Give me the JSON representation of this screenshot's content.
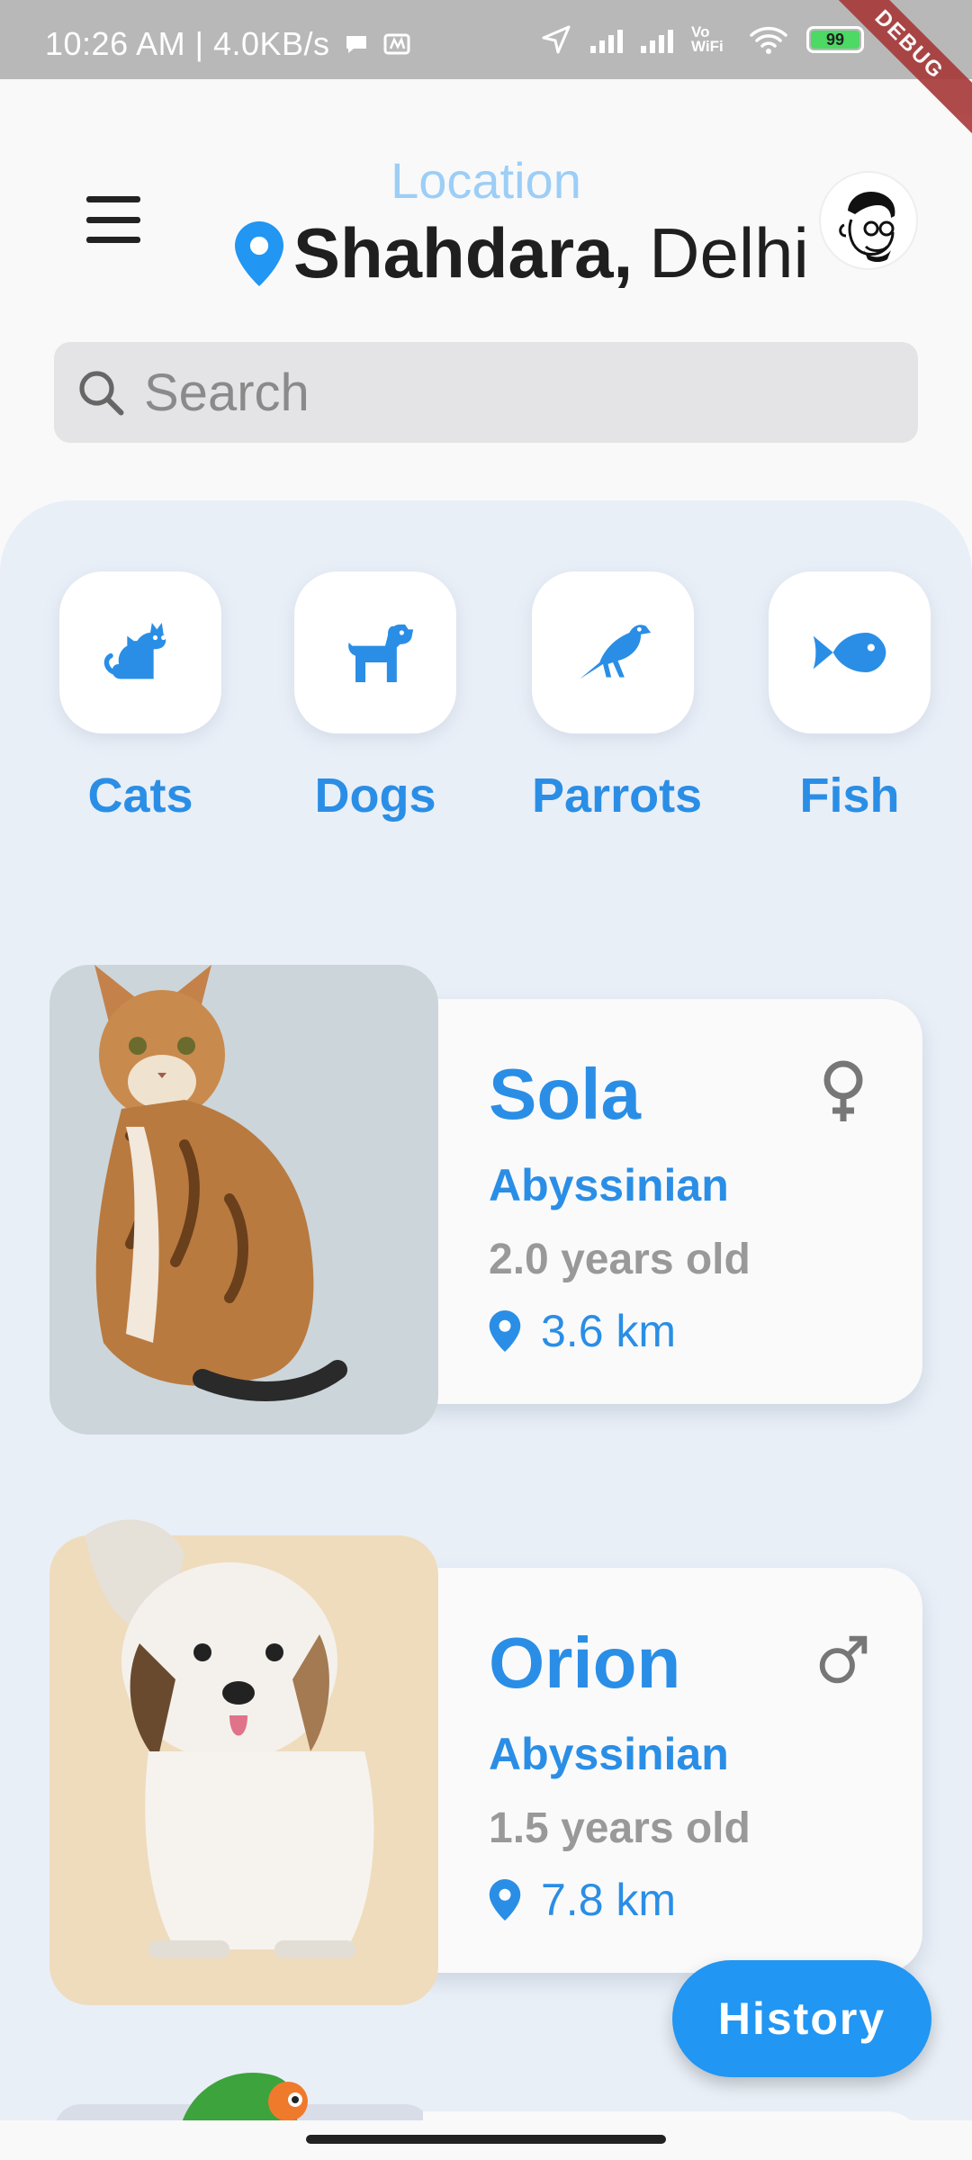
{
  "status_bar": {
    "time_speed": "10:26 AM | 4.0KB/s",
    "vowifi": "Vo WiFi",
    "battery": "99",
    "debug_banner": "DEBUG"
  },
  "header": {
    "location_label": "Location",
    "city": "Shahdara,",
    "state": "Delhi"
  },
  "search": {
    "placeholder": "Search"
  },
  "categories": [
    {
      "label": "Cats",
      "icon": "cat-icon"
    },
    {
      "label": "Dogs",
      "icon": "dog-icon"
    },
    {
      "label": "Parrots",
      "icon": "bird-icon"
    },
    {
      "label": "Fish",
      "icon": "fish-icon"
    }
  ],
  "pets": [
    {
      "name": "Sola",
      "breed": "Abyssinian",
      "age": "2.0 years old",
      "distance": "3.6 km",
      "gender": "female",
      "bg_color": "#ccd5da"
    },
    {
      "name": "Orion",
      "breed": "Abyssinian",
      "age": "1.5 years old",
      "distance": "7.8 km",
      "gender": "male",
      "bg_color": "#efdcbd"
    }
  ],
  "fab": {
    "label": "History"
  },
  "colors": {
    "accent": "#2a8ee6",
    "fab": "#2196f3",
    "panel": "#e9eff7"
  }
}
